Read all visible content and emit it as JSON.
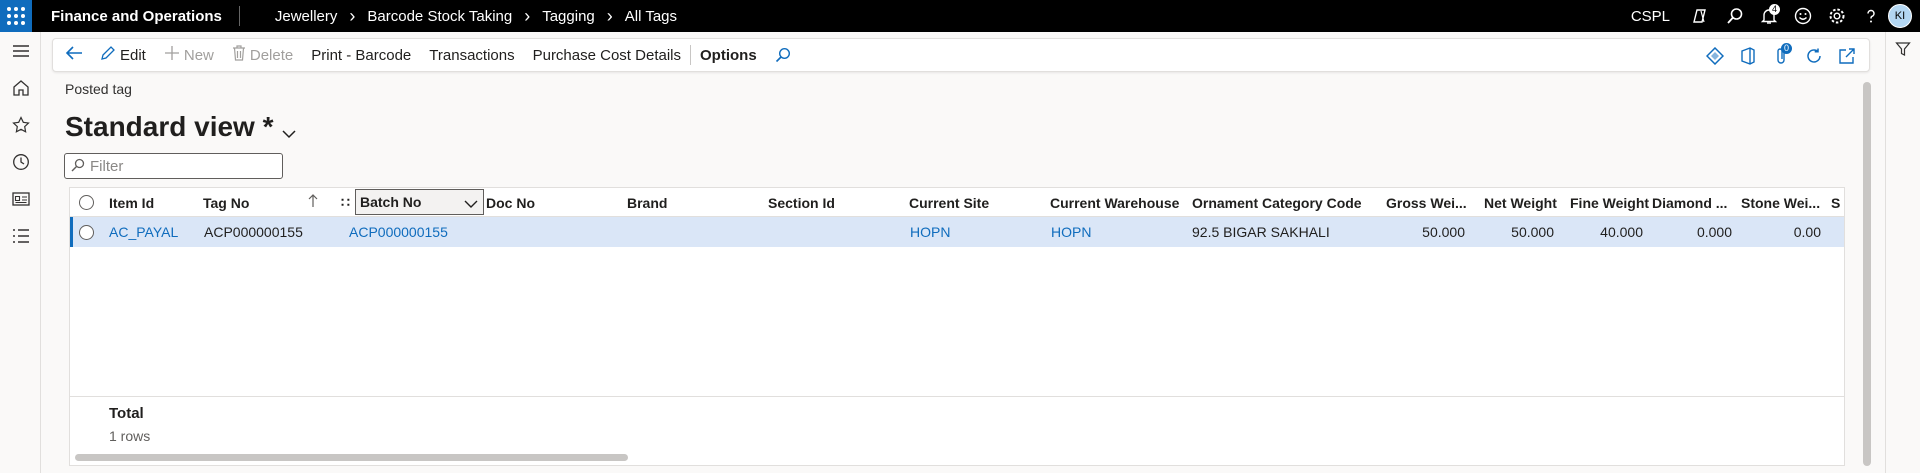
{
  "topbar": {
    "app_title": "Finance and Operations",
    "breadcrumbs": [
      "Jewellery",
      "Barcode Stock Taking",
      "Tagging",
      "All Tags"
    ],
    "company": "CSPL",
    "notification_count": "4",
    "avatar_initials": "KI"
  },
  "actions": {
    "edit": "Edit",
    "new": "New",
    "delete": "Delete",
    "print_barcode": "Print - Barcode",
    "transactions": "Transactions",
    "purchase_cost_details": "Purchase Cost Details",
    "options": "Options",
    "attachment_count": "0"
  },
  "page": {
    "caption": "Posted tag",
    "view_title": "Standard view *",
    "filter_placeholder": "Filter"
  },
  "grid": {
    "columns": [
      "Item Id",
      "Tag No",
      "Batch No",
      "Doc No",
      "Brand",
      "Section Id",
      "Current Site",
      "Current Warehouse",
      "Ornament Category Code",
      "Gross Wei...",
      "Net Weight",
      "Fine Weight",
      "Diamond ...",
      "Stone Wei...",
      "S"
    ],
    "rows": [
      {
        "item_id": "AC_PAYAL",
        "tag_no": "ACP000000155",
        "batch_no": "ACP000000155",
        "doc_no": "",
        "brand": "",
        "section_id": "",
        "current_site": "HOPN",
        "current_warehouse": "HOPN",
        "ornament_category_code": "92.5 BIGAR SAKHALI",
        "gross_weight": "50.000",
        "net_weight": "50.000",
        "fine_weight": "40.000",
        "diamond": "0.000",
        "stone_weight": "0.00"
      }
    ],
    "footer_total_label": "Total",
    "footer_row_count": "1 rows"
  },
  "colors": {
    "accent": "#0f6cbd",
    "selected_row": "#dae6f7",
    "topbar": "#000000"
  },
  "icons": [
    "waffle-icon",
    "back-arrow-icon",
    "edit-icon",
    "plus-icon",
    "trash-icon",
    "search-icon",
    "filter-icon",
    "home-icon",
    "star-icon",
    "clock-icon",
    "workspace-icon",
    "list-icon",
    "settings-icon",
    "help-icon",
    "smiley-icon",
    "bell-icon",
    "copilot-icon",
    "hamburger-icon"
  ]
}
